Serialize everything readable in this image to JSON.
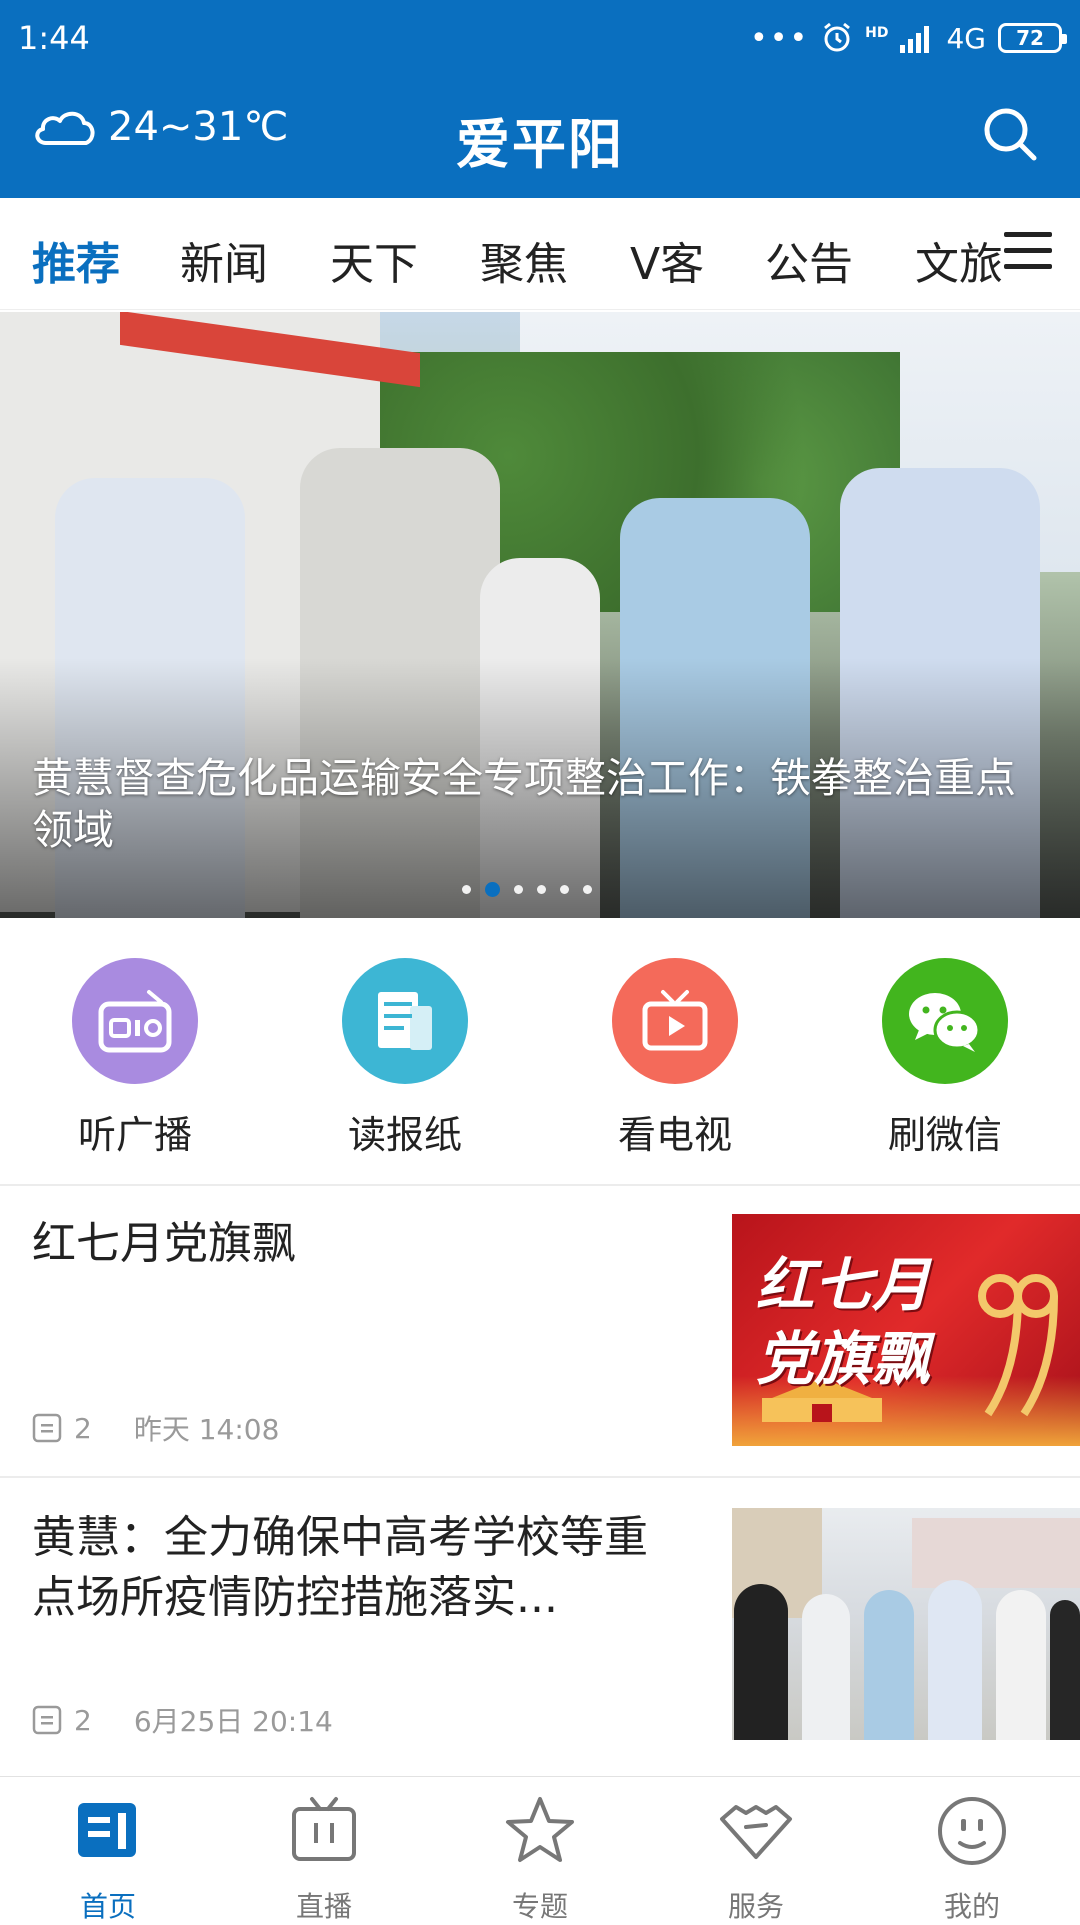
{
  "status_bar": {
    "time": "1:44",
    "dots": "•••",
    "network": "4G",
    "hd": "HD",
    "battery": "72"
  },
  "header": {
    "weather_temp": "24~31℃",
    "title": "爱平阳",
    "weather_icon": "cloud-icon",
    "search_icon": "search-icon"
  },
  "tabs": [
    {
      "label": "推荐",
      "active": true
    },
    {
      "label": "新闻"
    },
    {
      "label": "天下"
    },
    {
      "label": "聚焦"
    },
    {
      "label": "V客"
    },
    {
      "label": "公告"
    },
    {
      "label": "文旅"
    }
  ],
  "banner": {
    "caption": "黄慧督查危化品运输安全专项整治工作：铁拳整治重点领域",
    "dot_count": 6,
    "active_dot": 1
  },
  "shortcuts": [
    {
      "label": "听广播",
      "icon": "radio-icon",
      "color": "#a98be0"
    },
    {
      "label": "读报纸",
      "icon": "newspaper-icon",
      "color": "#3db6d4"
    },
    {
      "label": "看电视",
      "icon": "tv-icon",
      "color": "#f46a5a"
    },
    {
      "label": "刷微信",
      "icon": "wechat-icon",
      "color": "#42b51e"
    }
  ],
  "articles": [
    {
      "title": "红七月党旗飘",
      "comments": "2",
      "time": "昨天 14:08",
      "thumb_text": "红七月 党旗飘"
    },
    {
      "title": "黄慧：全力确保中高考学校等重点场所疫情防控措施落实...",
      "comments": "2",
      "time": "6月25日 20:14"
    }
  ],
  "bottom_nav": [
    {
      "label": "首页",
      "icon": "home-news-icon",
      "active": true
    },
    {
      "label": "直播",
      "icon": "live-tv-icon"
    },
    {
      "label": "专题",
      "icon": "star-icon"
    },
    {
      "label": "服务",
      "icon": "service-heart-icon"
    },
    {
      "label": "我的",
      "icon": "smile-face-icon"
    }
  ],
  "colors": {
    "brand": "#0a6fbf",
    "text": "#222222",
    "muted": "#9a9a9a"
  }
}
